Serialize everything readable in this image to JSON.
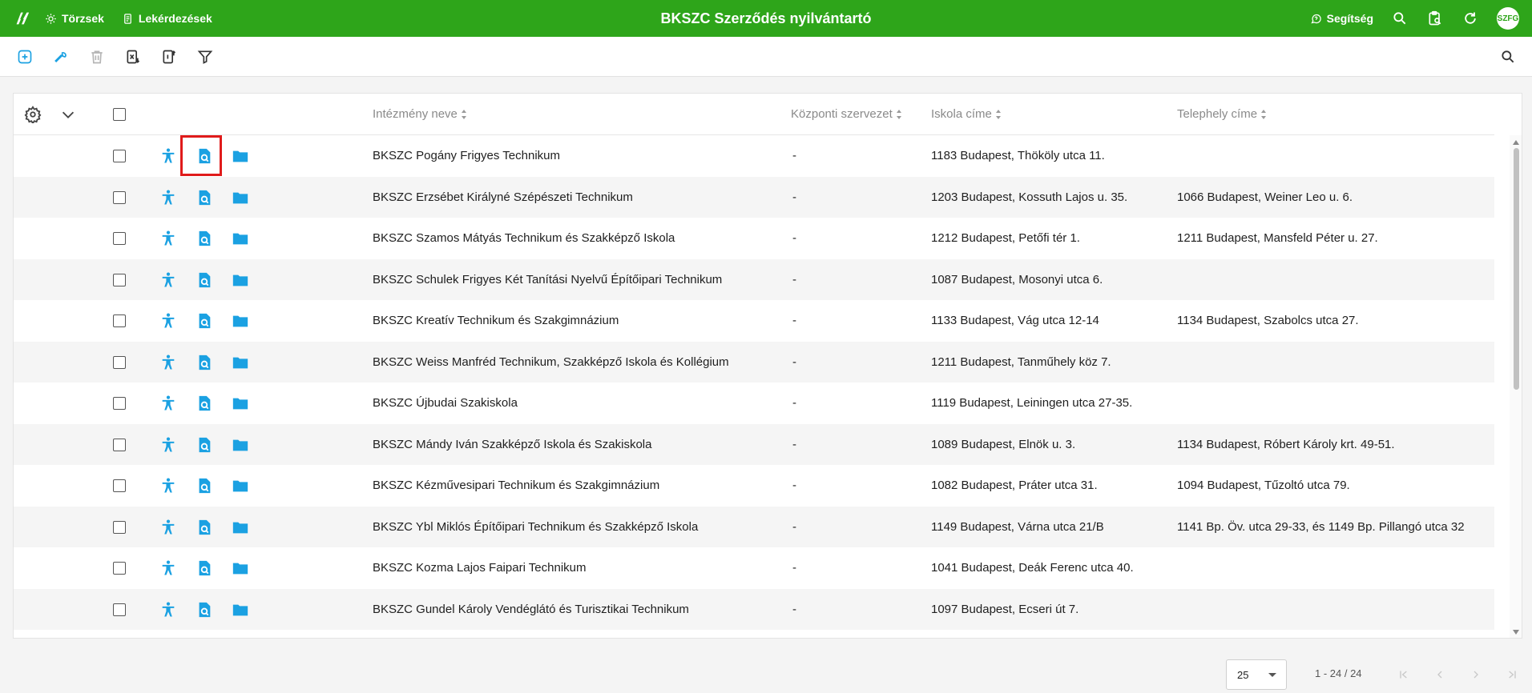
{
  "topbar": {
    "title": "BKSZC Szerződés nyilvántartó",
    "nav": [
      {
        "label": "Törzsek"
      },
      {
        "label": "Lekérdezések"
      }
    ],
    "help_label": "Segítség",
    "avatar": "SZFG"
  },
  "colors": {
    "brand_green": "#2ea51a",
    "icon_blue": "#1ba1e2",
    "highlight_red": "#e01b1b"
  },
  "table": {
    "columns": [
      {
        "key": "intezmeny",
        "label": "Intézmény neve"
      },
      {
        "key": "kozponti",
        "label": "Központi szervezet"
      },
      {
        "key": "iskola_cim",
        "label": "Iskola címe"
      },
      {
        "key": "telephely",
        "label": "Telephely címe"
      }
    ],
    "rows": [
      {
        "intezmeny": "BKSZC Pogány Frigyes Technikum",
        "kozponti": "-",
        "iskola_cim": "1183 Budapest, Thököly utca 11.",
        "telephely": ""
      },
      {
        "intezmeny": "BKSZC Erzsébet Királyné Szépészeti Technikum",
        "kozponti": "-",
        "iskola_cim": "1203 Budapest, Kossuth Lajos u. 35.",
        "telephely": "1066 Budapest, Weiner Leo u. 6."
      },
      {
        "intezmeny": "BKSZC Szamos Mátyás Technikum és Szakképző Iskola",
        "kozponti": "-",
        "iskola_cim": "1212 Budapest, Petőfi tér 1.",
        "telephely": "1211 Budapest, Mansfeld Péter u. 27."
      },
      {
        "intezmeny": "BKSZC Schulek Frigyes Két Tanítási Nyelvű Építőipari Technikum",
        "kozponti": "-",
        "iskola_cim": "1087 Budapest, Mosonyi utca 6.",
        "telephely": ""
      },
      {
        "intezmeny": "BKSZC Kreatív Technikum és Szakgimnázium",
        "kozponti": "-",
        "iskola_cim": "1133 Budapest, Vág utca 12-14",
        "telephely": "1134 Budapest, Szabolcs utca 27."
      },
      {
        "intezmeny": "BKSZC Weiss Manfréd Technikum, Szakképző Iskola és Kollégium",
        "kozponti": "-",
        "iskola_cim": "1211 Budapest, Tanműhely köz 7.",
        "telephely": ""
      },
      {
        "intezmeny": "BKSZC Újbudai Szakiskola",
        "kozponti": "-",
        "iskola_cim": "1119 Budapest, Leiningen utca 27-35.",
        "telephely": ""
      },
      {
        "intezmeny": "BKSZC Mándy Iván Szakképző Iskola és Szakiskola",
        "kozponti": "-",
        "iskola_cim": "1089 Budapest, Elnök u. 3.",
        "telephely": "1134 Budapest, Róbert Károly krt. 49-51."
      },
      {
        "intezmeny": "BKSZC Kézművesipari Technikum és Szakgimnázium",
        "kozponti": "-",
        "iskola_cim": "1082 Budapest, Práter utca 31.",
        "telephely": "1094 Budapest, Tűzoltó utca 79."
      },
      {
        "intezmeny": "BKSZC Ybl Miklós Építőipari Technikum és Szakképző Iskola",
        "kozponti": "-",
        "iskola_cim": "1149 Budapest, Várna utca 21/B",
        "telephely": "1141 Bp. Öv. utca 29-33, és 1149 Bp. Pillangó utca 32"
      },
      {
        "intezmeny": "BKSZC Kozma Lajos Faipari Technikum",
        "kozponti": "-",
        "iskola_cim": "1041 Budapest, Deák Ferenc utca 40.",
        "telephely": ""
      },
      {
        "intezmeny": "BKSZC Gundel Károly Vendéglátó és Turisztikai Technikum",
        "kozponti": "-",
        "iskola_cim": "1097 Budapest, Ecseri út 7.",
        "telephely": ""
      }
    ]
  },
  "pager": {
    "page_size": "25",
    "range": "1 - 24 / 24"
  }
}
